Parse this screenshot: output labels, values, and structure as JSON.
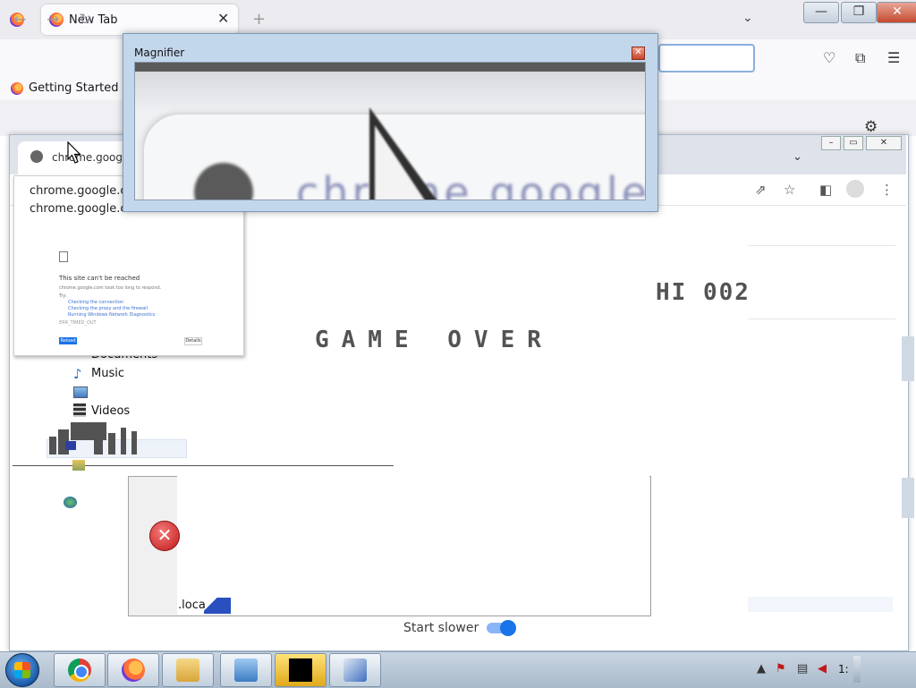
{
  "firefox": {
    "tab_label": "New Tab",
    "tab_close": "✕",
    "new_tab": "+",
    "tab_list": "⌄",
    "bookmark": "Getting Started"
  },
  "chrome": {
    "tab_label": "chrome.google.com",
    "tab_list": "⌄"
  },
  "game": {
    "hi_score": "HI 002",
    "game_over": "GAME OVER",
    "start_slower_label": "Start slower",
    "start_slower_on": true
  },
  "explorer": {
    "items": [
      "Documents",
      "Music",
      "Videos"
    ]
  },
  "error_dialog": {
    "fragment": ".loca"
  },
  "preview": {
    "line1": "chrome.google.com",
    "line2": "chrome.google.com",
    "mini_title": "This site can't be reached",
    "mini_sub": "chrome.google.com took too long to respond.",
    "mini_try": "Try:",
    "mini_bullets": [
      "Checking the connection",
      "Checking the proxy and the firewall",
      "Running Windows Network Diagnostics"
    ],
    "mini_code": "ERR_TIMED_OUT",
    "mini_reload": "Reload",
    "mini_details": "Details"
  },
  "magnifier": {
    "title": "Magnifier",
    "magnified_text": "chrome.google"
  },
  "tray": {
    "time_fragment": "1:"
  },
  "colors": {
    "chrome_accent": "#1a73e8",
    "game_ink": "#535353",
    "error_red": "#c11818"
  }
}
